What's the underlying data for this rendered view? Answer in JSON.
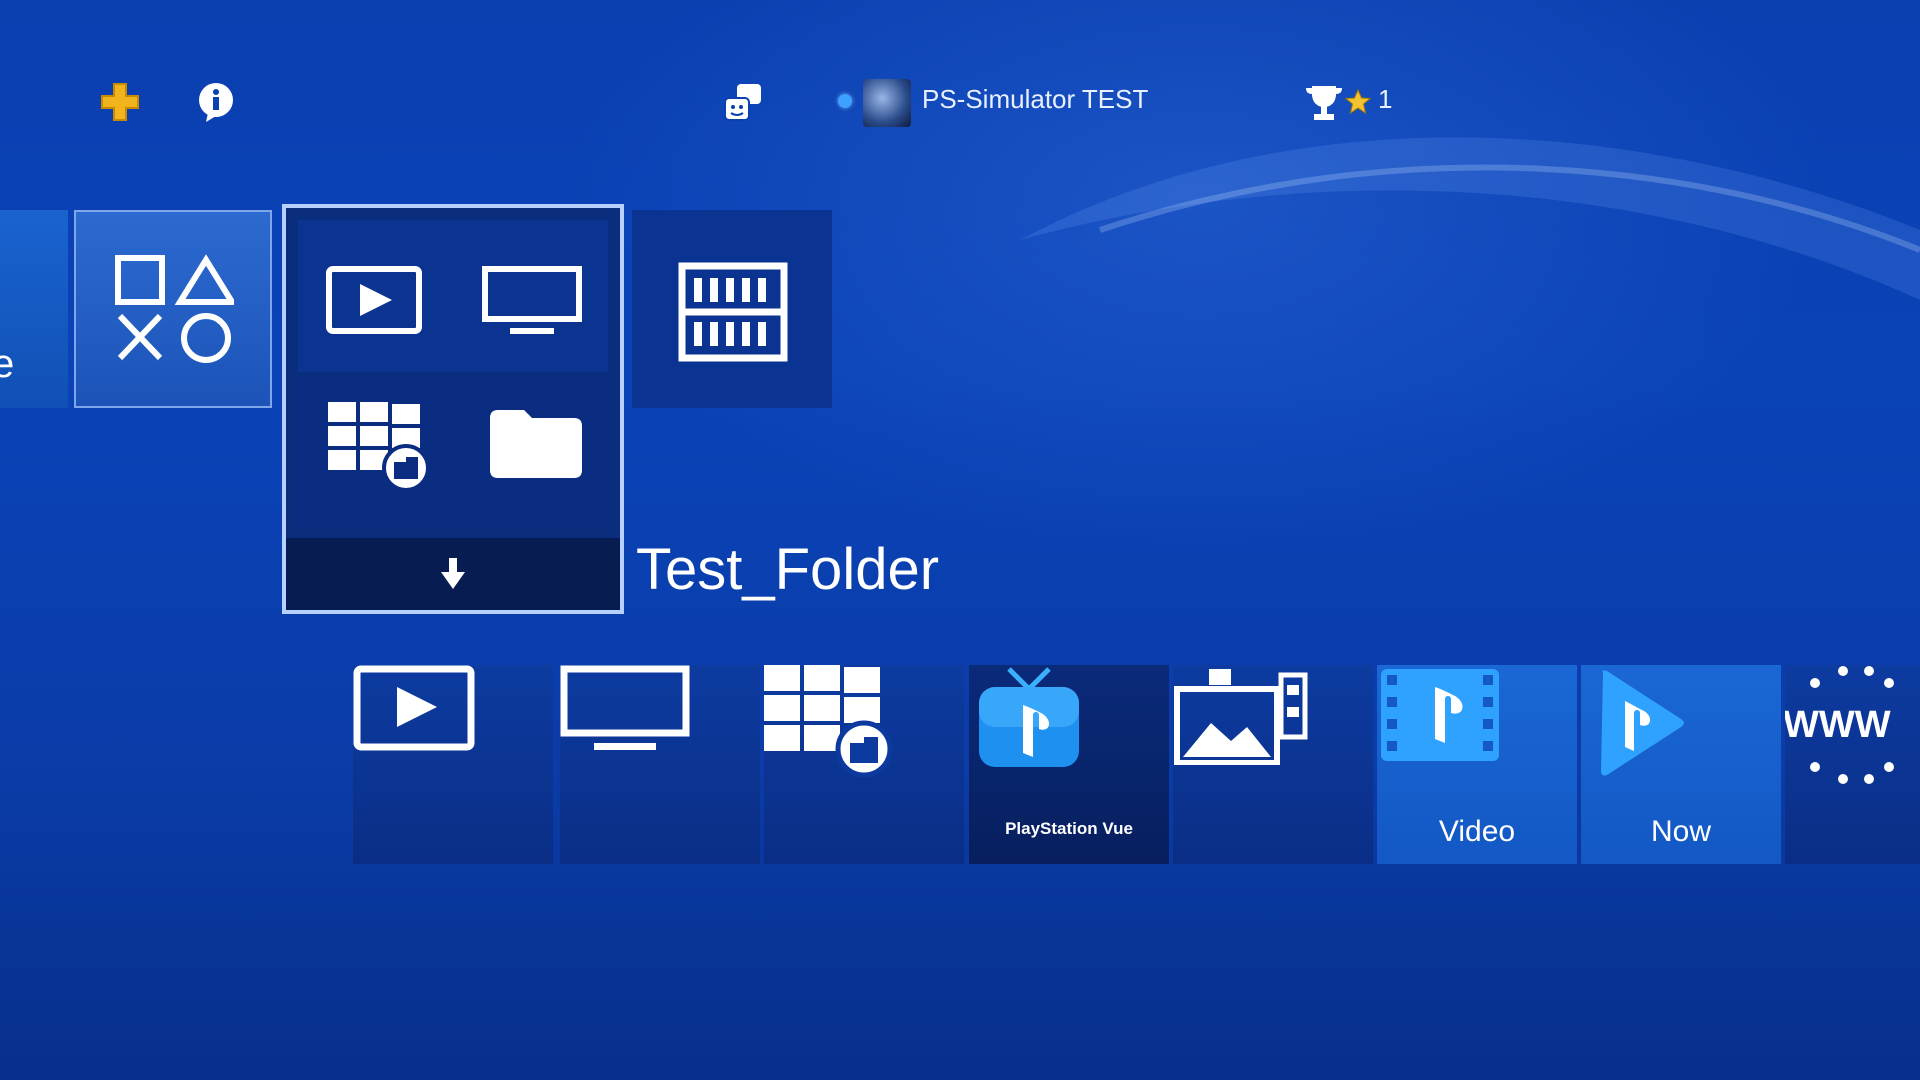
{
  "status_bar": {
    "plus_icon": "ps-plus-icon",
    "info_icon": "info-icon",
    "friends_icon": "friends-icon",
    "online_status_color": "#3ea0ff",
    "username": "PS-Simulator TEST",
    "trophy_icon": "trophy-icon",
    "trophy_level": "1"
  },
  "row_top": {
    "partial_tile_text": "e",
    "library_icon": "ps-shapes-icon",
    "folder": {
      "name": "Test_Folder",
      "contents_icons": [
        "play-icon",
        "tv-icon",
        "windows-share-icon",
        "folder-icon"
      ],
      "expand_icon": "down-arrow-icon"
    },
    "tv_video_icon": "tv-and-video-icon"
  },
  "row_bottom": {
    "tiles": [
      {
        "icon": "play-icon",
        "label": ""
      },
      {
        "icon": "tv-icon",
        "label": ""
      },
      {
        "icon": "windows-share-icon",
        "label": ""
      },
      {
        "icon": "playstation-vue-icon",
        "label": "PlayStation Vue"
      },
      {
        "icon": "capture-gallery-icon",
        "label": ""
      },
      {
        "icon": "playstation-video-icon",
        "label": "Video"
      },
      {
        "icon": "playstation-now-icon",
        "label": "Now"
      },
      {
        "icon": "internet-browser-icon",
        "label": "WWW"
      }
    ]
  },
  "colors": {
    "background": "#0a40b0",
    "tile": "#0b3391",
    "highlight_border": "#b7d0ff"
  }
}
